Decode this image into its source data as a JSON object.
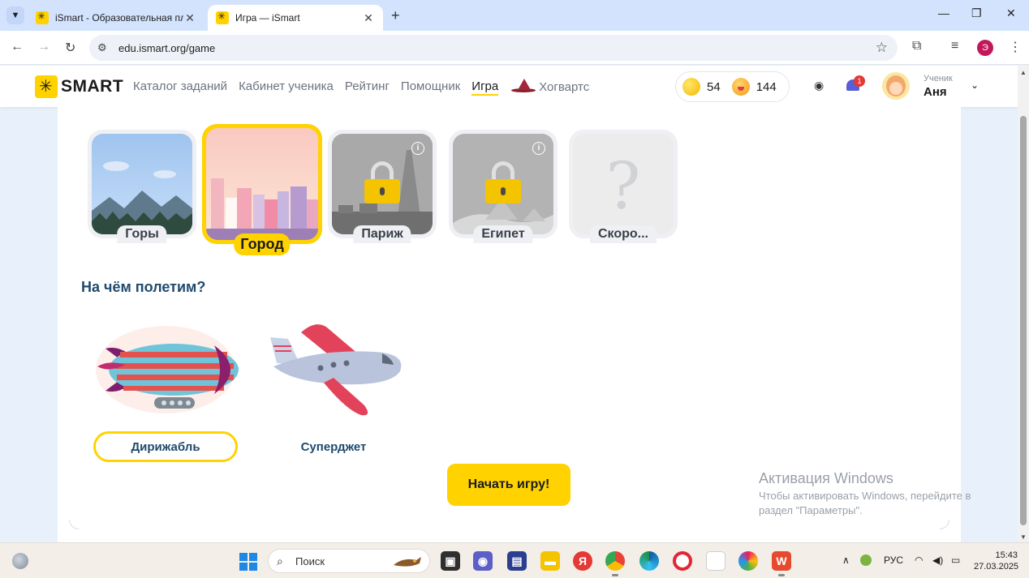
{
  "browser": {
    "tabs": [
      {
        "title": "iSmart - Образовательная пла",
        "close": "✕"
      },
      {
        "title": "Игра — iSmart",
        "close": "✕"
      }
    ],
    "new_tab": "+",
    "window_controls": {
      "minimize": "—",
      "maximize": "❐",
      "close": "✕"
    },
    "url": "edu.ismart.org/game",
    "profile_initial": "Э"
  },
  "header": {
    "logo_text": "SMART",
    "menu": [
      "Каталог заданий",
      "Кабинет ученика",
      "Рейтинг",
      "Помощник",
      "Игра",
      "Хогвартс"
    ],
    "active_menu": "Игра",
    "coins": "54",
    "smiles": "144",
    "notifications_count": "1",
    "user_role": "Ученик",
    "user_name": "Аня"
  },
  "locations": [
    {
      "name": "Горы",
      "locked": false,
      "selected": false
    },
    {
      "name": "Город",
      "locked": false,
      "selected": true
    },
    {
      "name": "Париж",
      "locked": true,
      "selected": false
    },
    {
      "name": "Египет",
      "locked": true,
      "selected": false
    },
    {
      "name": "Скоро...",
      "locked": false,
      "selected": false,
      "placeholder": "?"
    }
  ],
  "vehicle_section": {
    "title": "На чём полетим?",
    "vehicles": [
      {
        "name": "Дирижабль",
        "selected": true
      },
      {
        "name": "Суперджет",
        "selected": false
      }
    ]
  },
  "start_button": "Начать игру!",
  "windows_activation": {
    "title": "Активация Windows",
    "line1": "Чтобы активировать Windows, перейдите в",
    "line2": "раздел \"Параметры\"."
  },
  "taskbar": {
    "search_placeholder": "Поиск",
    "language": "РУС",
    "time": "15:43",
    "date": "27.03.2025"
  },
  "colors": {
    "accent": "#ffd200",
    "heading": "#1f4a6e",
    "tabstrip": "#d3e3fd"
  }
}
